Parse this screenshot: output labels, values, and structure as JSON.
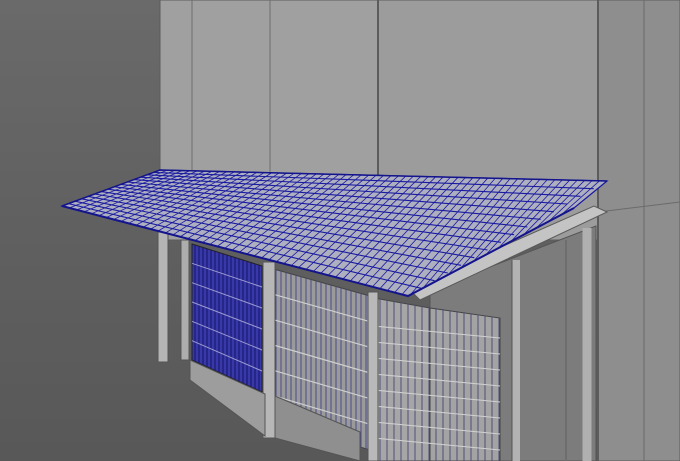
{
  "viewport": {
    "mode": "3d-modeling-viewport",
    "shading": "smooth-shade-with-wireframe-on-shaded"
  },
  "colors": {
    "background": "#5e5e5e",
    "wall_light": "#a2a2a2",
    "wall_mid": "#8f8f8f",
    "wall_dark": "#7a7a7a",
    "edge": "#5a5a5a",
    "wireframe": "#1a1aa0",
    "roof_tile": "#b8b8c4",
    "wood": "#b0b0b0"
  },
  "scene": {
    "objects": [
      "background-building",
      "tiled-roof-eave",
      "roof-support-beam",
      "left-posts",
      "lattice-screen-left",
      "sliding-shoji-doors",
      "foundation-plinth"
    ]
  }
}
